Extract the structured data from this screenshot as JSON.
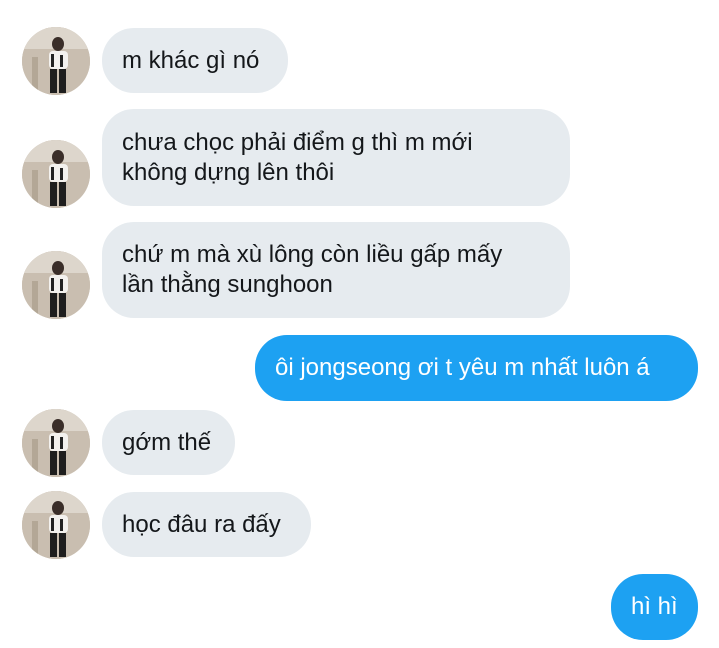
{
  "conversation": {
    "messages": [
      {
        "from": "them",
        "lines": [
          "m khác gì nó"
        ]
      },
      {
        "from": "them",
        "lines": [
          "chưa chọc phải điểm g thì m mới",
          "không dựng lên thôi"
        ]
      },
      {
        "from": "them",
        "lines": [
          "chứ m mà xù lông còn liều gấp mấy",
          "lần thằng sunghoon"
        ]
      },
      {
        "from": "me",
        "lines": [
          "ôi jongseong ơi t yêu m nhất luôn á"
        ]
      },
      {
        "from": "them",
        "lines": [
          "gớm thế"
        ]
      },
      {
        "from": "them",
        "lines": [
          "học đâu ra đấy"
        ]
      },
      {
        "from": "me",
        "lines": [
          "hì hì"
        ]
      }
    ]
  },
  "colors": {
    "incoming_bubble": "#e6ebef",
    "outgoing_bubble": "#1da1f2",
    "incoming_text": "#14171a",
    "outgoing_text": "#ffffff"
  },
  "icons": {
    "avatar": "user-avatar-photo"
  }
}
